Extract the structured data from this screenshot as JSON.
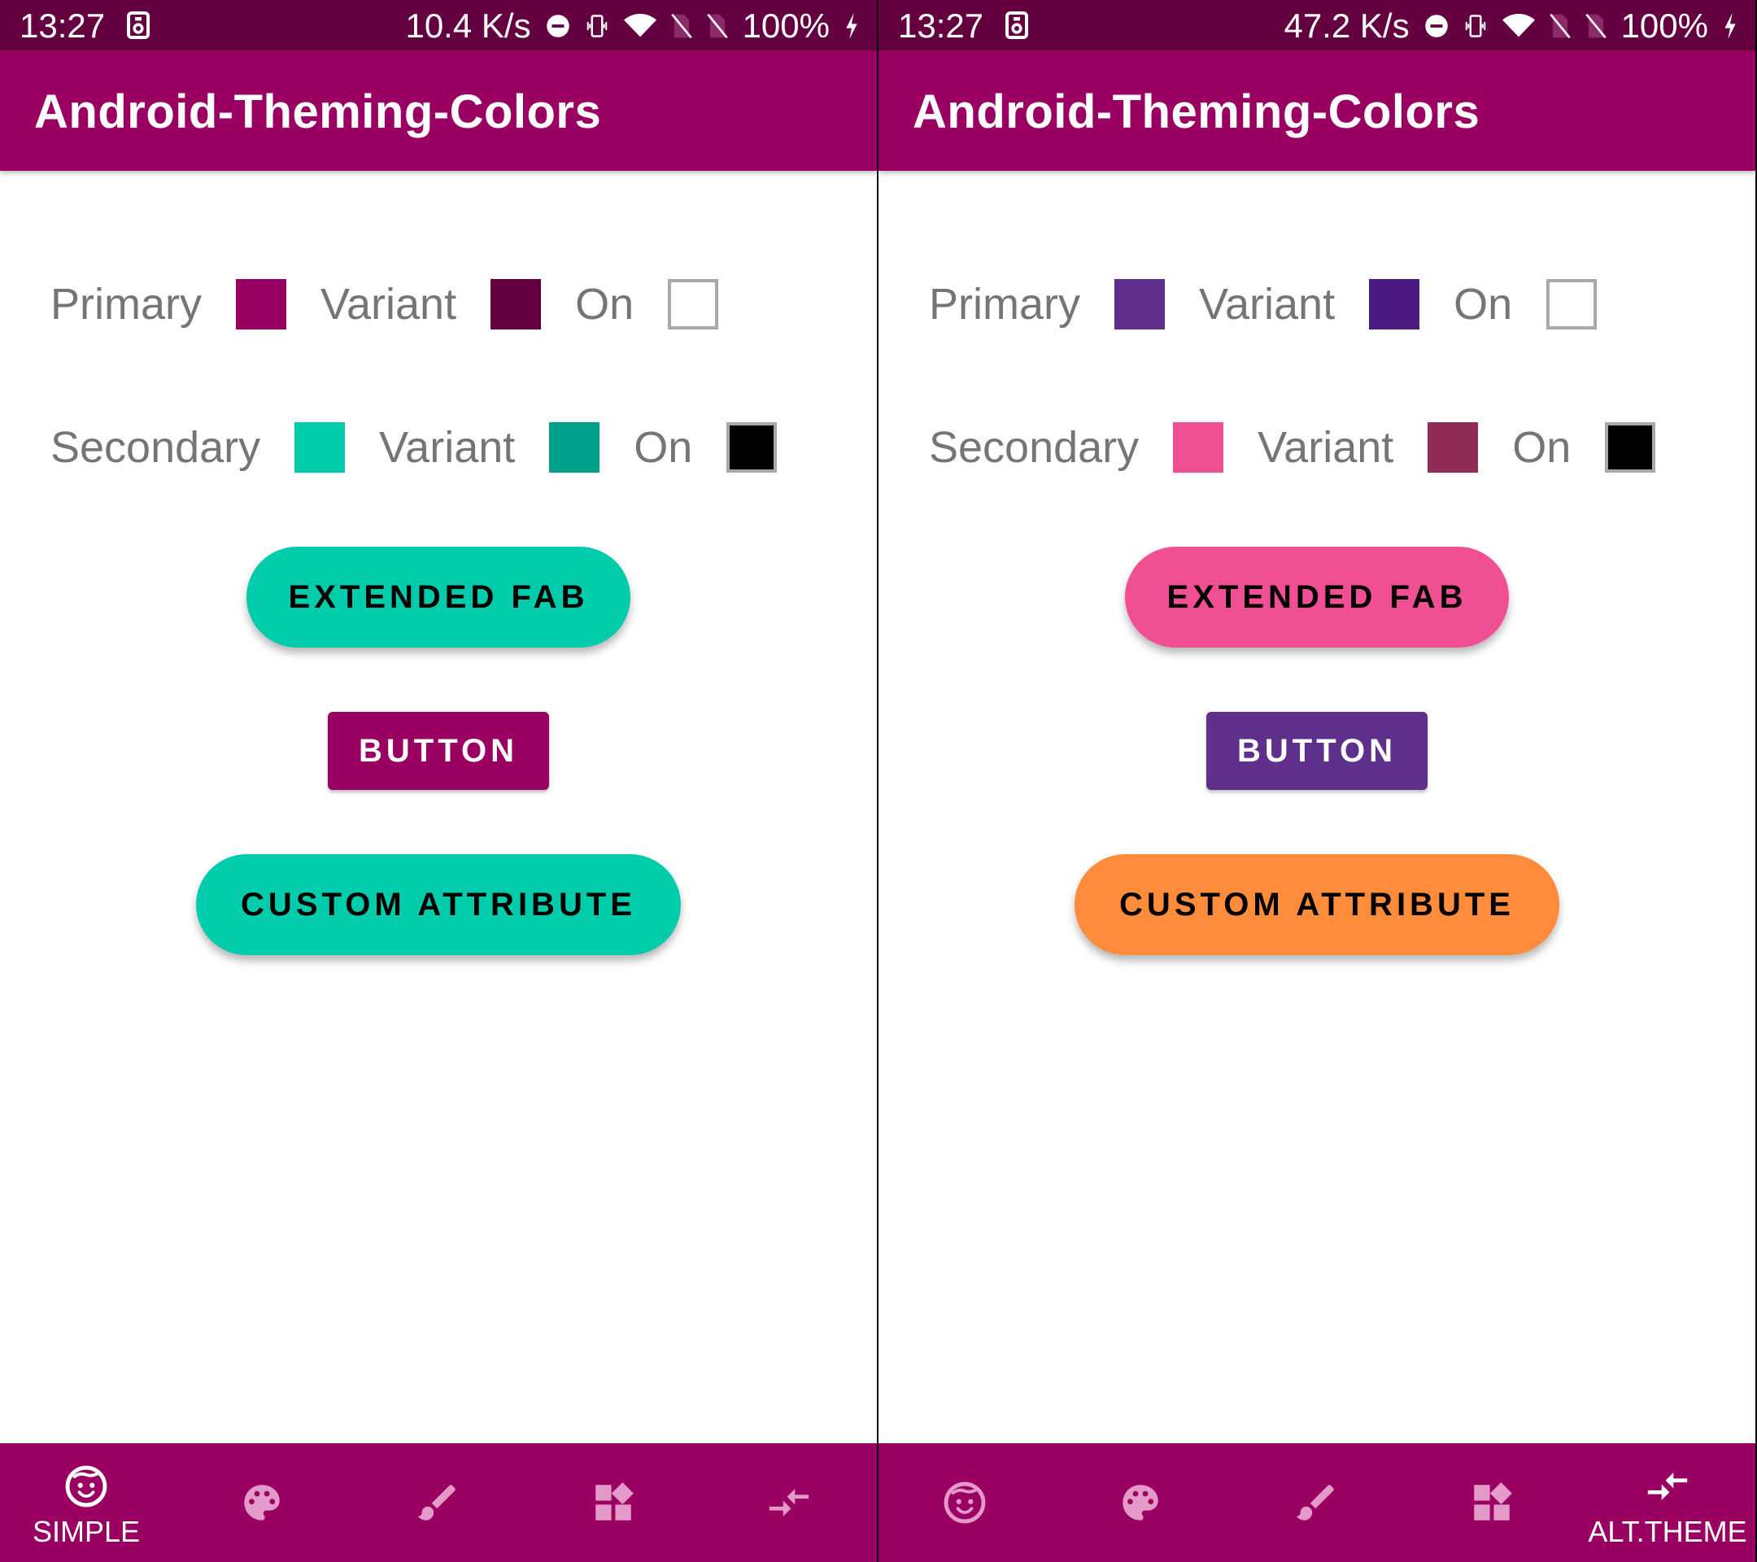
{
  "screens": [
    {
      "status": {
        "time": "13:27",
        "speed": "10.4 K/s",
        "battery": "100%"
      },
      "app_title": "Android-Theming-Colors",
      "rows": [
        {
          "label": "Primary",
          "color": "#9a0061",
          "variant_label": "Variant",
          "variant_color": "#640040",
          "on_label": "On",
          "on_color": "#ffffff"
        },
        {
          "label": "Secondary",
          "color": "#00cbab",
          "variant_label": "Variant",
          "variant_color": "#00a08a",
          "on_label": "On",
          "on_color": "#000000"
        }
      ],
      "buttons": {
        "extended_fab": {
          "label": "EXTENDED FAB",
          "color": "#00cbab"
        },
        "button": {
          "label": "BUTTON",
          "color": "#9a0061"
        },
        "custom_attribute": {
          "label": "CUSTOM ATTRIBUTE",
          "color": "#00cbab"
        }
      },
      "nav": {
        "items": [
          {
            "icon": "face-icon",
            "label": "SIMPLE",
            "selected": true
          },
          {
            "icon": "palette-icon",
            "label": "",
            "selected": false
          },
          {
            "icon": "brush-icon",
            "label": "",
            "selected": false
          },
          {
            "icon": "widgets-icon",
            "label": "",
            "selected": false
          },
          {
            "icon": "compare-arrows-icon",
            "label": "",
            "selected": false
          }
        ]
      }
    },
    {
      "status": {
        "time": "13:27",
        "speed": "47.2 K/s",
        "battery": "100%"
      },
      "app_title": "Android-Theming-Colors",
      "rows": [
        {
          "label": "Primary",
          "color": "#5e308c",
          "variant_label": "Variant",
          "variant_color": "#4a1a80",
          "on_label": "On",
          "on_color": "#ffffff"
        },
        {
          "label": "Secondary",
          "color": "#f04f93",
          "variant_label": "Variant",
          "variant_color": "#912c58",
          "on_label": "On",
          "on_color": "#000000"
        }
      ],
      "buttons": {
        "extended_fab": {
          "label": "EXTENDED FAB",
          "color": "#f04f93"
        },
        "button": {
          "label": "BUTTON",
          "color": "#5e308c"
        },
        "custom_attribute": {
          "label": "CUSTOM ATTRIBUTE",
          "color": "#ff8c3b"
        }
      },
      "nav": {
        "items": [
          {
            "icon": "face-icon",
            "label": "",
            "selected": false
          },
          {
            "icon": "palette-icon",
            "label": "",
            "selected": false
          },
          {
            "icon": "brush-icon",
            "label": "",
            "selected": false
          },
          {
            "icon": "widgets-icon",
            "label": "",
            "selected": false
          },
          {
            "icon": "compare-arrows-icon",
            "label": "ALT.THEME",
            "selected": true
          }
        ]
      }
    }
  ],
  "colors": {
    "nav_bg": "#9a0061",
    "status_bg": "#640040",
    "nav_icon_inactive": "#e39ac9",
    "nav_icon_active": "#ffffff",
    "label_text": "#757575"
  }
}
